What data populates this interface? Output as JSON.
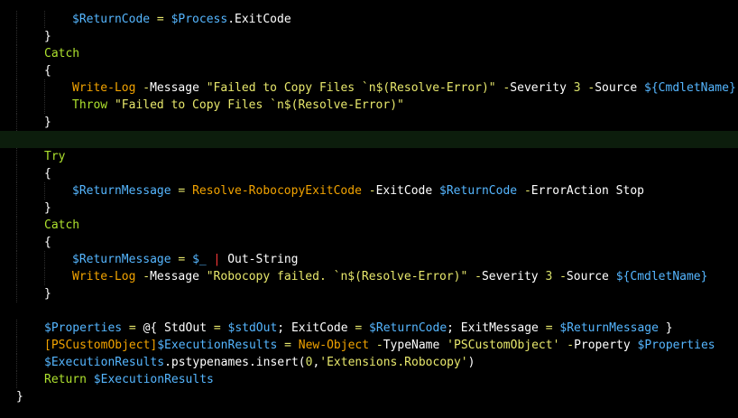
{
  "editor": {
    "colors": {
      "background": "#000000",
      "current_line": "#0c1d0c",
      "keyword": "#aee22e",
      "variable": "#55b6ff",
      "string": "#e8e86c",
      "operator": "#e8e86c",
      "command": "#f2a300",
      "parameter": "#ffffff",
      "number": "#d7e06a",
      "pipe": "#ff3a3a",
      "text": "#ffffff"
    },
    "current_line_index": 7,
    "lines": [
      {
        "indent": 2,
        "tokens": [
          {
            "t": "var",
            "v": "$ReturnCode"
          },
          {
            "t": "txt",
            "v": " "
          },
          {
            "t": "op",
            "v": "="
          },
          {
            "t": "txt",
            "v": " "
          },
          {
            "t": "var",
            "v": "$Process"
          },
          {
            "t": "txt",
            "v": ".ExitCode"
          }
        ]
      },
      {
        "indent": 1,
        "tokens": [
          {
            "t": "txt",
            "v": "}"
          }
        ]
      },
      {
        "indent": 1,
        "tokens": [
          {
            "t": "kw",
            "v": "Catch"
          }
        ]
      },
      {
        "indent": 1,
        "tokens": [
          {
            "t": "txt",
            "v": "{"
          }
        ]
      },
      {
        "indent": 2,
        "tokens": [
          {
            "t": "cmd",
            "v": "Write-Log"
          },
          {
            "t": "txt",
            "v": " "
          },
          {
            "t": "op",
            "v": "-"
          },
          {
            "t": "prm",
            "v": "Message"
          },
          {
            "t": "txt",
            "v": " "
          },
          {
            "t": "str",
            "v": "\"Failed to Copy Files `n$(Resolve-Error)\""
          },
          {
            "t": "txt",
            "v": " "
          },
          {
            "t": "op",
            "v": "-"
          },
          {
            "t": "prm",
            "v": "Severity"
          },
          {
            "t": "txt",
            "v": " "
          },
          {
            "t": "num",
            "v": "3"
          },
          {
            "t": "txt",
            "v": " "
          },
          {
            "t": "op",
            "v": "-"
          },
          {
            "t": "prm",
            "v": "Source"
          },
          {
            "t": "txt",
            "v": " "
          },
          {
            "t": "var",
            "v": "${CmdletName}"
          }
        ]
      },
      {
        "indent": 2,
        "tokens": [
          {
            "t": "kw",
            "v": "Throw"
          },
          {
            "t": "txt",
            "v": " "
          },
          {
            "t": "str",
            "v": "\"Failed to Copy Files `n$(Resolve-Error)\""
          }
        ]
      },
      {
        "indent": 1,
        "tokens": [
          {
            "t": "txt",
            "v": "}"
          }
        ]
      },
      {
        "indent": 0,
        "tokens": []
      },
      {
        "indent": 1,
        "tokens": [
          {
            "t": "kw",
            "v": "Try"
          }
        ]
      },
      {
        "indent": 1,
        "tokens": [
          {
            "t": "txt",
            "v": "{"
          }
        ]
      },
      {
        "indent": 2,
        "tokens": [
          {
            "t": "var",
            "v": "$ReturnMessage"
          },
          {
            "t": "txt",
            "v": " "
          },
          {
            "t": "op",
            "v": "="
          },
          {
            "t": "txt",
            "v": " "
          },
          {
            "t": "cmd",
            "v": "Resolve-RobocopyExitCode"
          },
          {
            "t": "txt",
            "v": " "
          },
          {
            "t": "op",
            "v": "-"
          },
          {
            "t": "prm",
            "v": "ExitCode"
          },
          {
            "t": "txt",
            "v": " "
          },
          {
            "t": "var",
            "v": "$ReturnCode"
          },
          {
            "t": "txt",
            "v": " "
          },
          {
            "t": "op",
            "v": "-"
          },
          {
            "t": "prm",
            "v": "ErrorAction"
          },
          {
            "t": "txt",
            "v": " Stop"
          }
        ]
      },
      {
        "indent": 1,
        "tokens": [
          {
            "t": "txt",
            "v": "}"
          }
        ]
      },
      {
        "indent": 1,
        "tokens": [
          {
            "t": "kw",
            "v": "Catch"
          }
        ]
      },
      {
        "indent": 1,
        "tokens": [
          {
            "t": "txt",
            "v": "{"
          }
        ]
      },
      {
        "indent": 2,
        "tokens": [
          {
            "t": "var",
            "v": "$ReturnMessage"
          },
          {
            "t": "txt",
            "v": " "
          },
          {
            "t": "op",
            "v": "="
          },
          {
            "t": "txt",
            "v": " "
          },
          {
            "t": "var",
            "v": "$_"
          },
          {
            "t": "txt",
            "v": " "
          },
          {
            "t": "pipe",
            "v": "|"
          },
          {
            "t": "txt",
            "v": " Out-String"
          }
        ]
      },
      {
        "indent": 2,
        "tokens": [
          {
            "t": "cmd",
            "v": "Write-Log"
          },
          {
            "t": "txt",
            "v": " "
          },
          {
            "t": "op",
            "v": "-"
          },
          {
            "t": "prm",
            "v": "Message"
          },
          {
            "t": "txt",
            "v": " "
          },
          {
            "t": "str",
            "v": "\"Robocopy failed. `n$(Resolve-Error)\""
          },
          {
            "t": "txt",
            "v": " "
          },
          {
            "t": "op",
            "v": "-"
          },
          {
            "t": "prm",
            "v": "Severity"
          },
          {
            "t": "txt",
            "v": " "
          },
          {
            "t": "num",
            "v": "3"
          },
          {
            "t": "txt",
            "v": " "
          },
          {
            "t": "op",
            "v": "-"
          },
          {
            "t": "prm",
            "v": "Source"
          },
          {
            "t": "txt",
            "v": " "
          },
          {
            "t": "var",
            "v": "${CmdletName}"
          }
        ]
      },
      {
        "indent": 1,
        "tokens": [
          {
            "t": "txt",
            "v": "}"
          }
        ]
      },
      {
        "indent": 0,
        "tokens": []
      },
      {
        "indent": 1,
        "tokens": [
          {
            "t": "var",
            "v": "$Properties"
          },
          {
            "t": "txt",
            "v": " "
          },
          {
            "t": "op",
            "v": "="
          },
          {
            "t": "txt",
            "v": " @{ StdOut "
          },
          {
            "t": "op",
            "v": "="
          },
          {
            "t": "txt",
            "v": " "
          },
          {
            "t": "var",
            "v": "$stdOut"
          },
          {
            "t": "txt",
            "v": "; ExitCode "
          },
          {
            "t": "op",
            "v": "="
          },
          {
            "t": "txt",
            "v": " "
          },
          {
            "t": "var",
            "v": "$ReturnCode"
          },
          {
            "t": "txt",
            "v": "; ExitMessage "
          },
          {
            "t": "op",
            "v": "="
          },
          {
            "t": "txt",
            "v": " "
          },
          {
            "t": "var",
            "v": "$ReturnMessage"
          },
          {
            "t": "txt",
            "v": " }"
          }
        ]
      },
      {
        "indent": 1,
        "tokens": [
          {
            "t": "cmd",
            "v": "[PSCustomObject]"
          },
          {
            "t": "var",
            "v": "$ExecutionResults"
          },
          {
            "t": "txt",
            "v": " "
          },
          {
            "t": "op",
            "v": "="
          },
          {
            "t": "txt",
            "v": " "
          },
          {
            "t": "cmd",
            "v": "New-Object"
          },
          {
            "t": "txt",
            "v": " "
          },
          {
            "t": "op",
            "v": "-"
          },
          {
            "t": "prm",
            "v": "TypeName"
          },
          {
            "t": "txt",
            "v": " "
          },
          {
            "t": "str",
            "v": "'PSCustomObject'"
          },
          {
            "t": "txt",
            "v": " "
          },
          {
            "t": "op",
            "v": "-"
          },
          {
            "t": "prm",
            "v": "Property"
          },
          {
            "t": "txt",
            "v": " "
          },
          {
            "t": "var",
            "v": "$Properties"
          }
        ]
      },
      {
        "indent": 1,
        "tokens": [
          {
            "t": "var",
            "v": "$ExecutionResults"
          },
          {
            "t": "txt",
            "v": ".pstypenames.insert("
          },
          {
            "t": "num",
            "v": "0"
          },
          {
            "t": "txt",
            "v": ","
          },
          {
            "t": "str",
            "v": "'Extensions.Robocopy'"
          },
          {
            "t": "txt",
            "v": ")"
          }
        ]
      },
      {
        "indent": 1,
        "tokens": [
          {
            "t": "kw",
            "v": "Return"
          },
          {
            "t": "txt",
            "v": " "
          },
          {
            "t": "var",
            "v": "$ExecutionResults"
          }
        ]
      },
      {
        "indent": 0,
        "tokens": [
          {
            "t": "txt",
            "v": "}"
          }
        ]
      }
    ]
  }
}
